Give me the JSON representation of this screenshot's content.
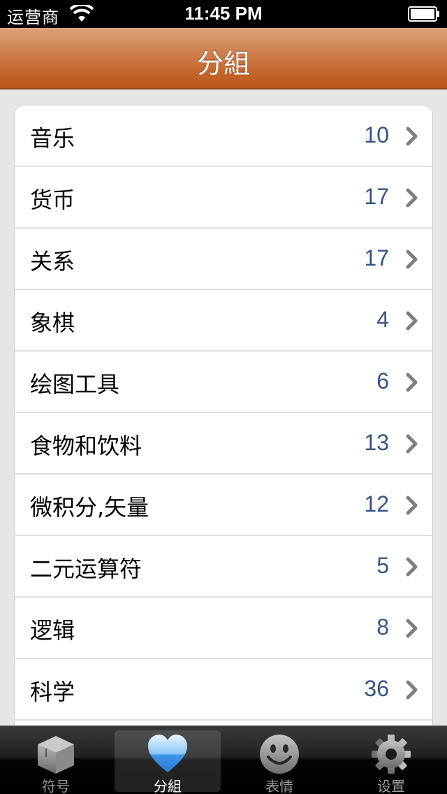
{
  "status_bar": {
    "carrier": "运营商",
    "time": "11:45 PM"
  },
  "nav": {
    "title": "分組"
  },
  "list": [
    {
      "label": "音乐",
      "count": "10"
    },
    {
      "label": "货币",
      "count": "17"
    },
    {
      "label": "关系",
      "count": "17"
    },
    {
      "label": "象棋",
      "count": "4"
    },
    {
      "label": "绘图工具",
      "count": "6"
    },
    {
      "label": "食物和饮料",
      "count": "13"
    },
    {
      "label": "微积分,矢量",
      "count": "12"
    },
    {
      "label": "二元运算符",
      "count": "5"
    },
    {
      "label": "逻辑",
      "count": "8"
    },
    {
      "label": "科学",
      "count": "36"
    }
  ],
  "tabs": [
    {
      "label": "符号",
      "icon": "box-icon",
      "selected": false
    },
    {
      "label": "分組",
      "icon": "heart-icon",
      "selected": true
    },
    {
      "label": "表情",
      "icon": "smiley-icon",
      "selected": false
    },
    {
      "label": "设置",
      "icon": "gear-icon",
      "selected": false
    }
  ],
  "colors": {
    "nav_bar": "#c4652c",
    "count_text": "#385487",
    "tab_bar": "#000000"
  }
}
